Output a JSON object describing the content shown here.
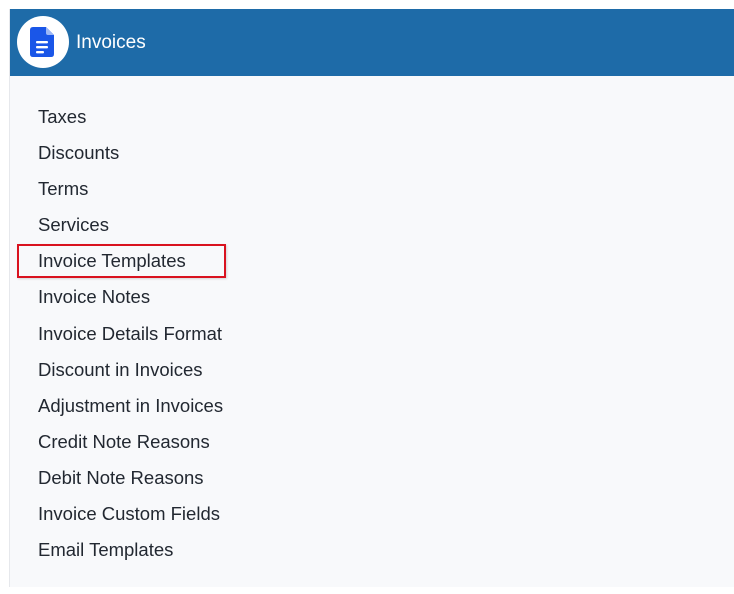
{
  "header": {
    "title": "Invoices",
    "icon": "document-icon",
    "background": "#1e6ba8",
    "icon_color": "#1a56e8"
  },
  "menu": {
    "items": [
      {
        "label": "Taxes",
        "highlighted": false
      },
      {
        "label": "Discounts",
        "highlighted": false
      },
      {
        "label": "Terms",
        "highlighted": false
      },
      {
        "label": "Services",
        "highlighted": false
      },
      {
        "label": "Invoice Templates",
        "highlighted": true
      },
      {
        "label": "Invoice Notes",
        "highlighted": false
      },
      {
        "label": "Invoice Details Format",
        "highlighted": false
      },
      {
        "label": "Discount in Invoices",
        "highlighted": false
      },
      {
        "label": "Adjustment in Invoices",
        "highlighted": false
      },
      {
        "label": "Credit Note Reasons",
        "highlighted": false
      },
      {
        "label": "Debit Note Reasons",
        "highlighted": false
      },
      {
        "label": "Invoice Custom Fields",
        "highlighted": false
      },
      {
        "label": "Email Templates",
        "highlighted": false
      }
    ],
    "highlight_color": "#d9121f"
  }
}
